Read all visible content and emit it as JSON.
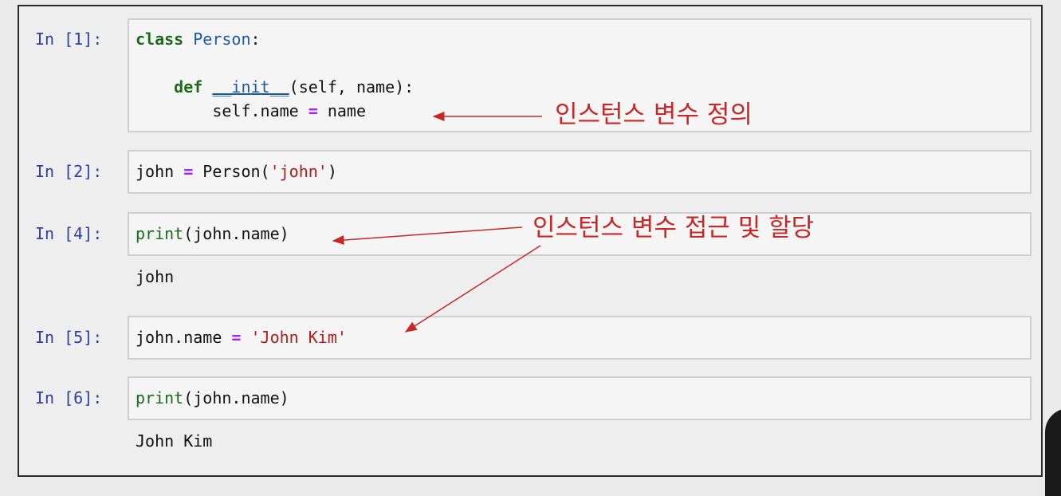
{
  "cells": [
    {
      "prompt": "In [1]:",
      "lines": [
        {
          "kw": "class",
          "sp": " ",
          "cls": "Person",
          "rest": ":"
        },
        {
          "text": ""
        },
        {
          "indent": "    ",
          "kw": "def",
          "sp": " ",
          "fn": "__init__",
          "rest": "(self, name):"
        },
        {
          "indent": "        ",
          "a": "self.name",
          "op": "=",
          "b": "name"
        }
      ]
    },
    {
      "prompt": "In [2]:",
      "pre": "john ",
      "op": "=",
      "mid": " Person(",
      "str": "'john'",
      "post": ")"
    },
    {
      "prompt": "In [4]:",
      "builtin": "print",
      "rest": "(john.name)",
      "output": "john"
    },
    {
      "prompt": "In [5]:",
      "pre": "john.name ",
      "op": "=",
      "str": "'John Kim'"
    },
    {
      "prompt": "In [6]:",
      "builtin": "print",
      "rest": "(john.name)",
      "output": "John Kim"
    }
  ],
  "annotations": {
    "define": "인스턴스 변수 정의",
    "access": "인스턴스 변수 접근 및 할당"
  },
  "colors": {
    "annotation": "#c62828",
    "prompt": "#303f9f",
    "keyword": "#1b6b1b",
    "string": "#b21c1c",
    "operator": "#aa22ff"
  }
}
